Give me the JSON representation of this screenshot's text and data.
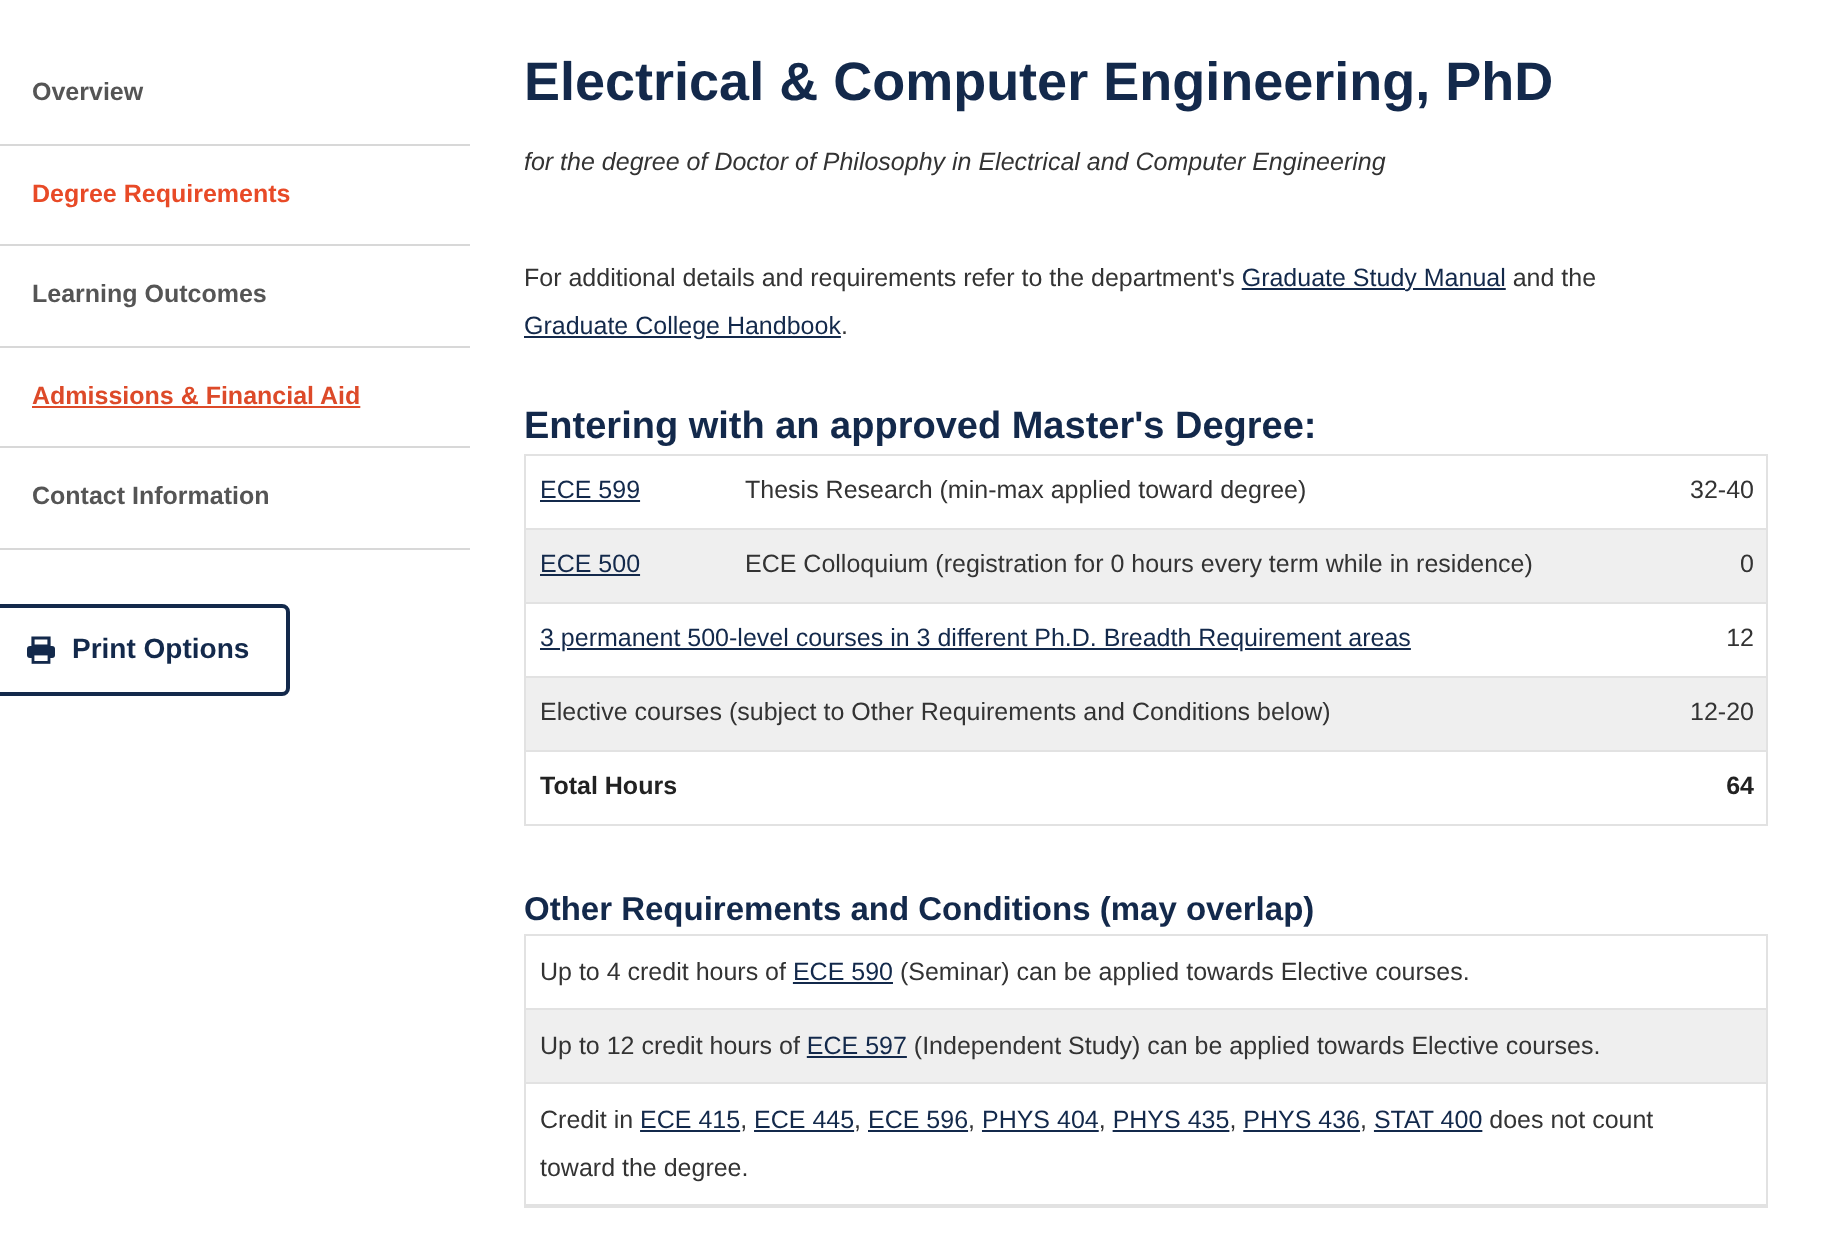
{
  "sidebar": {
    "items": [
      {
        "label": "Overview",
        "selected": false,
        "hovered": false
      },
      {
        "label": "Degree Requirements",
        "selected": true,
        "hovered": false
      },
      {
        "label": "Learning Outcomes",
        "selected": false,
        "hovered": false
      },
      {
        "label": "Admissions & Financial Aid",
        "selected": false,
        "hovered": true
      },
      {
        "label": "Contact Information",
        "selected": false,
        "hovered": false
      }
    ],
    "print_button": "Print Options"
  },
  "title": "Electrical & Computer Engineering, PhD",
  "subtitle": "for the degree of Doctor of Philosophy in Electrical and Computer Engineering",
  "intro": [
    {
      "text": "For additional details and requirements refer to the department's ",
      "link": false
    },
    {
      "text": "Graduate Study Manual",
      "link": true
    },
    {
      "text": " and the ",
      "link": false
    },
    {
      "text": "Graduate College Handbook",
      "link": true
    },
    {
      "text": ".",
      "link": false
    }
  ],
  "requirements": {
    "heading": "Entering with an approved Master's Degree:",
    "rows": [
      {
        "kind": "course",
        "code": "ECE 599",
        "description": "Thesis Research (min-max applied toward degree)",
        "hours": "32-40"
      },
      {
        "kind": "course",
        "code": "ECE 500",
        "description": "ECE Colloquium (registration for 0 hours every term while in residence)",
        "hours": "0"
      },
      {
        "kind": "link",
        "description": "3 permanent 500-level courses in 3 different Ph.D. Breadth Requirement areas",
        "hours": "12"
      },
      {
        "kind": "plain",
        "description": "Elective courses (subject to Other Requirements and Conditions below)",
        "hours": "12-20"
      },
      {
        "kind": "total",
        "description": "Total Hours",
        "hours": "64"
      }
    ]
  },
  "conditions": {
    "heading": "Other Requirements and Conditions (may overlap)",
    "rows": [
      {
        "segments": [
          {
            "text": "Up to 4 credit hours of ",
            "link": false
          },
          {
            "text": "ECE 590",
            "link": true
          },
          {
            "text": " (Seminar) can be applied towards Elective courses.",
            "link": false
          }
        ]
      },
      {
        "segments": [
          {
            "text": "Up to 12 credit hours of ",
            "link": false
          },
          {
            "text": "ECE 597",
            "link": true
          },
          {
            "text": " (Independent Study) can be applied towards Elective courses.",
            "link": false
          }
        ]
      },
      {
        "segments": [
          {
            "text": "Credit in ",
            "link": false
          },
          {
            "text": "ECE 415",
            "link": true
          },
          {
            "text": ", ",
            "link": false
          },
          {
            "text": "ECE 445",
            "link": true
          },
          {
            "text": ", ",
            "link": false
          },
          {
            "text": "ECE 596",
            "link": true
          },
          {
            "text": ", ",
            "link": false
          },
          {
            "text": "PHYS 404",
            "link": true
          },
          {
            "text": ", ",
            "link": false
          },
          {
            "text": "PHYS 435",
            "link": true
          },
          {
            "text": ", ",
            "link": false
          },
          {
            "text": "PHYS 436",
            "link": true
          },
          {
            "text": ", ",
            "link": false
          },
          {
            "text": "STAT 400",
            "link": true
          },
          {
            "text": " does not count toward the degree.",
            "link": false
          }
        ]
      }
    ]
  }
}
